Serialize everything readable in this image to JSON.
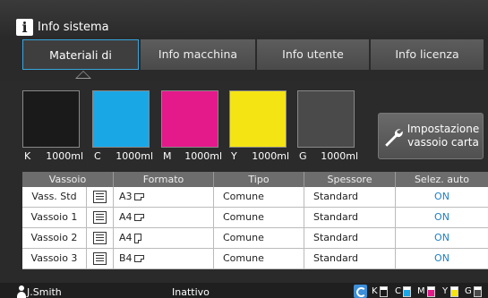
{
  "window": {
    "title": "Info sistema",
    "title_icon": "info-icon"
  },
  "tabs": [
    {
      "label": "Materiali di consumo",
      "active": true
    },
    {
      "label": "Info macchina",
      "active": false
    },
    {
      "label": "Info utente",
      "active": false
    },
    {
      "label": "Info licenza",
      "active": false
    }
  ],
  "consumables": [
    {
      "key": "K",
      "amount": "1000ml",
      "color": "#1a1a1a"
    },
    {
      "key": "C",
      "amount": "1000ml",
      "color": "#1aa7e6"
    },
    {
      "key": "M",
      "amount": "1000ml",
      "color": "#e4198a"
    },
    {
      "key": "Y",
      "amount": "1000ml",
      "color": "#f4e414"
    },
    {
      "key": "G",
      "amount": "1000ml",
      "color": "#4a4a4a"
    }
  ],
  "tray_settings_button": {
    "label_line1": "Impostazione",
    "label_line2": "vassoio carta",
    "icon": "wrench-icon"
  },
  "table": {
    "headers": [
      "Vassoio",
      "Formato",
      "Tipo",
      "Spessore",
      "Selez. auto"
    ],
    "rows": [
      {
        "tray": "Vass. Std",
        "format": "A3",
        "orientation": "landscape",
        "type": "Comune",
        "thickness": "Standard",
        "auto": "ON"
      },
      {
        "tray": "Vassoio 1",
        "format": "A4",
        "orientation": "landscape",
        "type": "Comune",
        "thickness": "Standard",
        "auto": "ON"
      },
      {
        "tray": "Vassoio 2",
        "format": "A4",
        "orientation": "portrait",
        "type": "Comune",
        "thickness": "Standard",
        "auto": "ON"
      },
      {
        "tray": "Vassoio 3",
        "format": "B4",
        "orientation": "landscape",
        "type": "Comune",
        "thickness": "Standard",
        "auto": "ON"
      }
    ]
  },
  "status": {
    "user": "J.Smith",
    "state": "Inattivo",
    "levels": [
      {
        "key": "K",
        "color": "#1a1a1a"
      },
      {
        "key": "C",
        "color": "#1aa7e6"
      },
      {
        "key": "M",
        "color": "#e4198a"
      },
      {
        "key": "Y",
        "color": "#f4e414"
      },
      {
        "key": "G",
        "color": "#4a4a4a"
      }
    ]
  },
  "colors": {
    "accent": "#39a6dc",
    "auto_on": "#1c7fc4"
  }
}
